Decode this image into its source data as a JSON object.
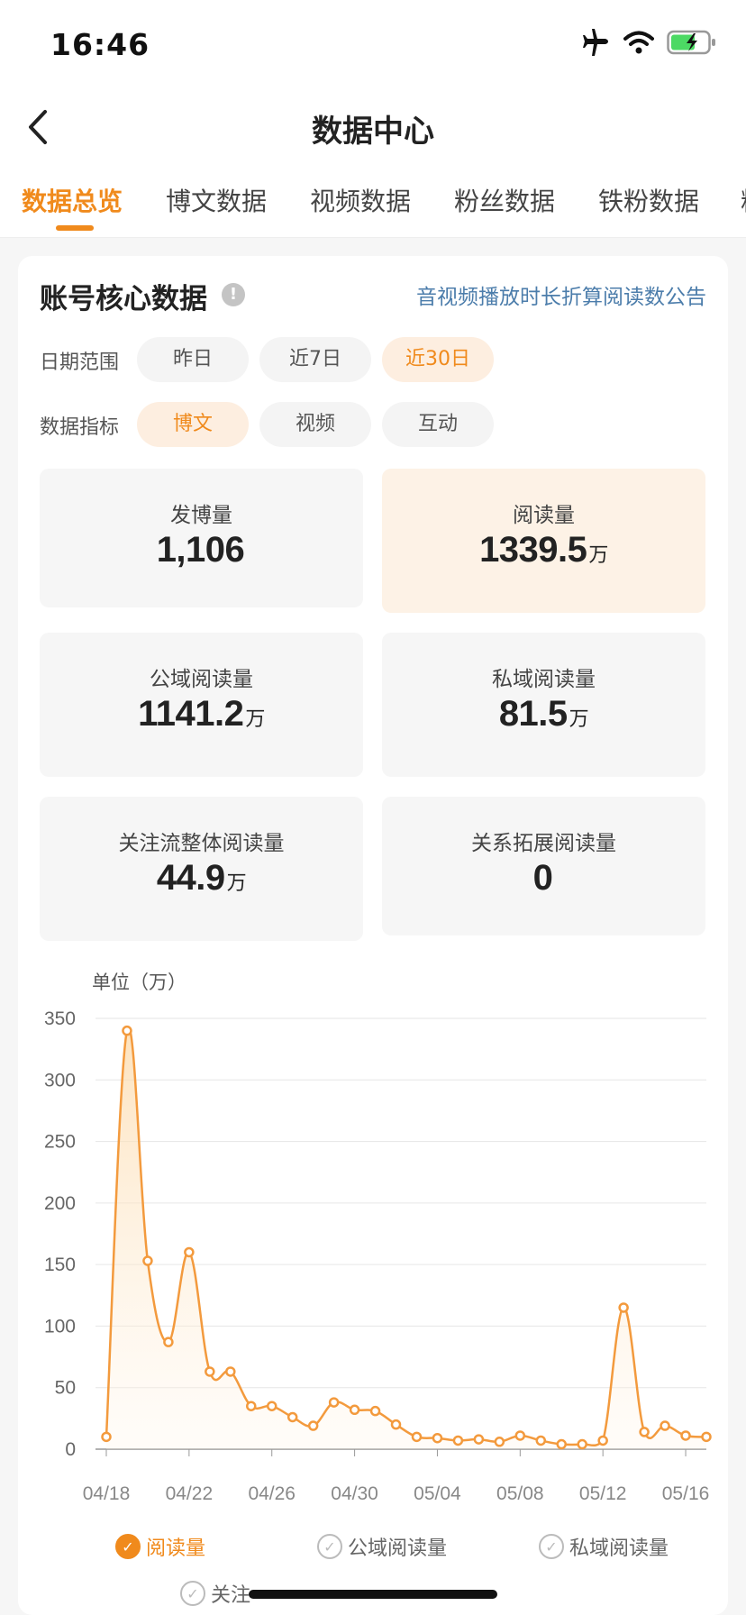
{
  "status_bar": {
    "time": "16:46"
  },
  "nav": {
    "title": "数据中心"
  },
  "tabs": [
    {
      "label": "数据总览",
      "active": true
    },
    {
      "label": "博文数据"
    },
    {
      "label": "视频数据"
    },
    {
      "label": "粉丝数据"
    },
    {
      "label": "铁粉数据"
    },
    {
      "label": "粉"
    }
  ],
  "card": {
    "title": "账号核心数据",
    "info_icon": "!",
    "notice_link": "音视频播放时长折算阅读数公告"
  },
  "filters": {
    "date_range": {
      "label": "日期范围",
      "options": [
        "昨日",
        "近7日",
        "近30日"
      ],
      "selected": "近30日"
    },
    "metric": {
      "label": "数据指标",
      "options": [
        "博文",
        "视频",
        "互动"
      ],
      "selected": "博文"
    }
  },
  "stats": [
    {
      "label": "发博量",
      "value": "1,106",
      "unit": ""
    },
    {
      "label": "阅读量",
      "value": "1339.5",
      "unit": "万"
    },
    {
      "label": "公域阅读量",
      "value": "1141.2",
      "unit": "万"
    },
    {
      "label": "私域阅读量",
      "value": "81.5",
      "unit": "万"
    },
    {
      "label": "关注流整体阅读量",
      "value": "44.9",
      "unit": "万"
    },
    {
      "label": "关系拓展阅读量",
      "value": "0",
      "unit": ""
    }
  ],
  "chart_unit_label": "单位（万）",
  "chart_data": {
    "type": "area",
    "ylabel": "",
    "ylim": [
      0,
      350
    ],
    "yticks": [
      "350",
      "300",
      "250",
      "200",
      "150",
      "100",
      "50",
      "0"
    ],
    "xtick_labels": [
      "04/18",
      "04/22",
      "04/26",
      "04/30",
      "05/04",
      "05/08",
      "05/12",
      "05/16"
    ],
    "x": [
      "04/18",
      "04/19",
      "04/20",
      "04/21",
      "04/22",
      "04/23",
      "04/24",
      "04/25",
      "04/26",
      "04/27",
      "04/28",
      "04/29",
      "04/30",
      "05/01",
      "05/02",
      "05/03",
      "05/04",
      "05/05",
      "05/06",
      "05/07",
      "05/08",
      "05/09",
      "05/10",
      "05/11",
      "05/12",
      "05/13",
      "05/14",
      "05/15",
      "05/16",
      "05/17"
    ],
    "series": [
      {
        "name": "阅读量",
        "color": "#f39a3d",
        "values": [
          10,
          340,
          153,
          87,
          160,
          63,
          63,
          35,
          35,
          26,
          19,
          38,
          32,
          31,
          20,
          10,
          9,
          7,
          8,
          6,
          11,
          7,
          4,
          4,
          7,
          115,
          14,
          19,
          11,
          10
        ]
      }
    ]
  },
  "legend": [
    {
      "label": "阅读量",
      "active": true
    },
    {
      "label": "公域阅读量",
      "active": false
    },
    {
      "label": "私域阅读量",
      "active": false
    },
    {
      "label": "关注",
      "active": false
    }
  ]
}
